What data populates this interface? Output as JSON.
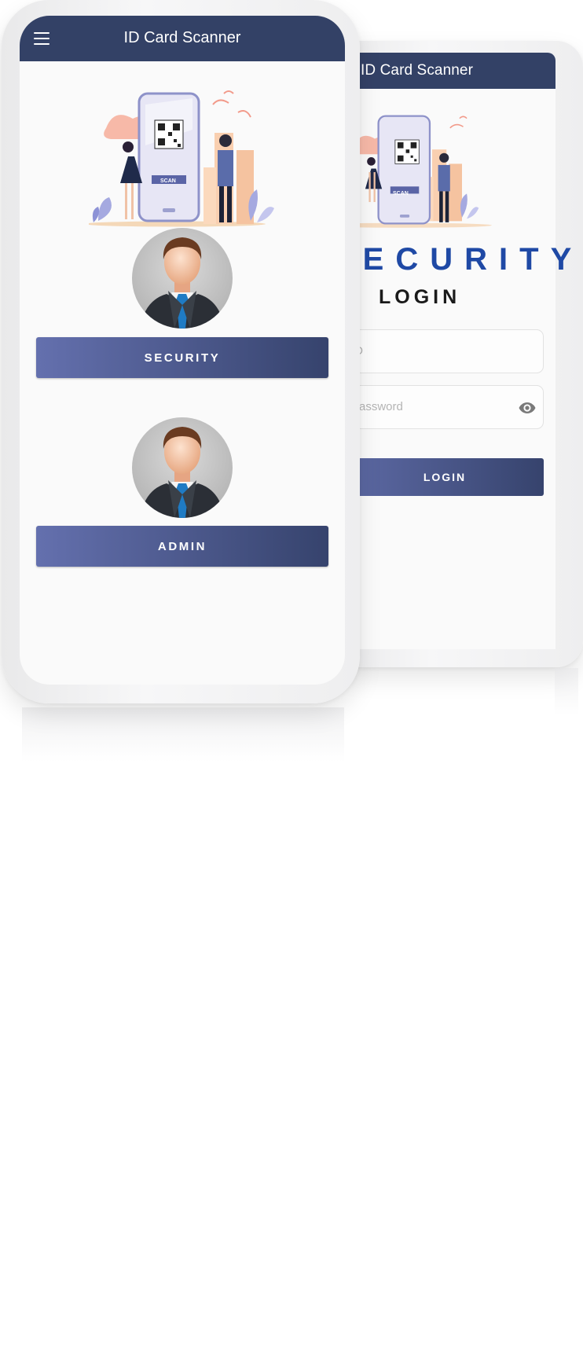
{
  "back_phone": {
    "app_title": "ID Card Scanner",
    "role_heading": "SECURITY",
    "login_heading": "LOGIN",
    "id_field": {
      "placeholder": "ID"
    },
    "password_field": {
      "placeholder": "Password"
    },
    "login_button": "LOGIN",
    "illustration_label": "SCAN"
  },
  "front_phone": {
    "app_title": "ID Card Scanner",
    "illustration_label": "SCAN",
    "roles": [
      {
        "label": "SECURITY"
      },
      {
        "label": "ADMIN"
      }
    ]
  },
  "colors": {
    "appbar": "#334166",
    "button_gradient_start": "#6470ae",
    "button_gradient_end": "#36436d",
    "security_heading": "#1f49a5"
  },
  "icons": [
    "hamburger-menu-icon",
    "eye-icon",
    "avatar-businessman"
  ]
}
